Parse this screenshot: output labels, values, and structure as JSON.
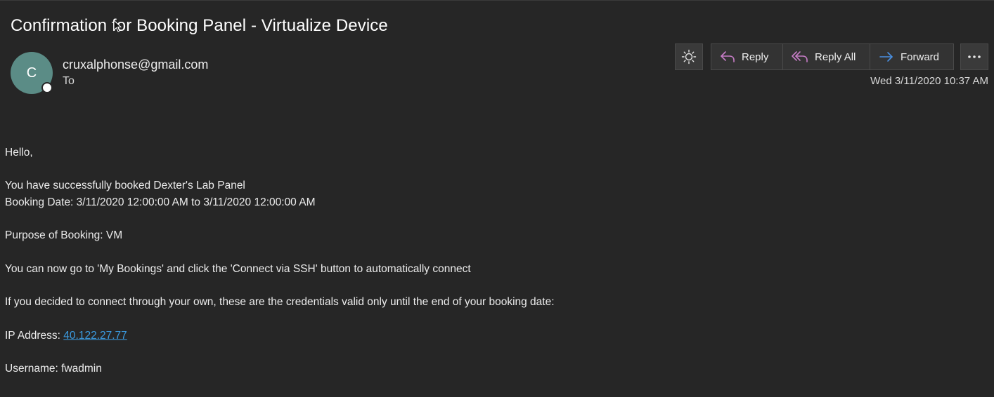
{
  "email": {
    "subject": "Confirmation for Booking Panel - Virtualize Device",
    "avatar_initial": "C",
    "sender": "cruxalphonse@gmail.com",
    "to_label": "To",
    "timestamp": "Wed 3/11/2020 10:37 AM"
  },
  "toolbar": {
    "theme_icon": "sun-icon",
    "reply_label": "Reply",
    "reply_all_label": "Reply All",
    "forward_label": "Forward",
    "more_icon": "more-icon",
    "reply_color": "#c77dc7",
    "forward_color": "#4a90e2"
  },
  "body": {
    "greeting": "Hello,",
    "line_booked": "You have successfully booked Dexter's Lab Panel",
    "line_booking_date": "Booking Date: 3/11/2020 12:00:00 AM to 3/11/2020 12:00:00 AM",
    "line_purpose": "Purpose of Booking: VM",
    "line_connect": "You can now go to 'My Bookings' and click the 'Connect via SSH' button to automatically connect",
    "line_credentials": "If you decided to connect through your own, these are the credentials valid only until the end of your booking date:",
    "ip_label": "IP Address: ",
    "ip_value": "40.122.27.77",
    "line_username": "Username: fwadmin"
  },
  "colors": {
    "background": "#262626",
    "avatar": "#5b8c86",
    "link": "#3b9be0"
  }
}
